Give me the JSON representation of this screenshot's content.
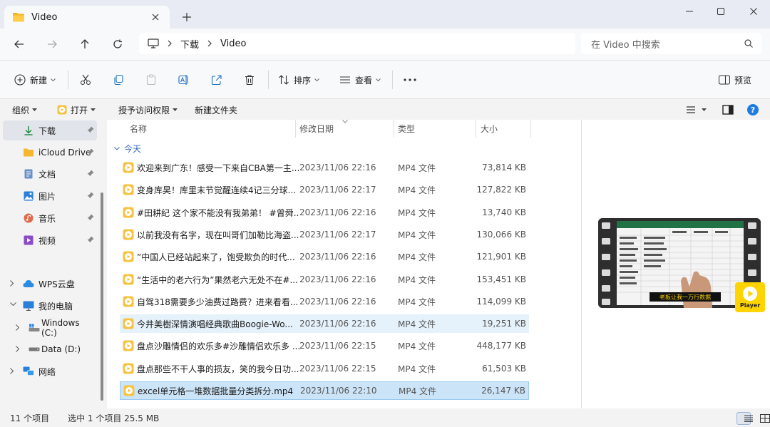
{
  "tab": {
    "title": "Video"
  },
  "address": {
    "segments": [
      "下载",
      "Video"
    ]
  },
  "search": {
    "placeholder": "在 Video 中搜索"
  },
  "toolbar": {
    "new_label": "新建",
    "sort_label": "排序",
    "view_label": "查看",
    "preview_label": "预览"
  },
  "commands": {
    "organize": "组织",
    "open": "打开",
    "grant_access": "授予访问权限",
    "new_folder": "新建文件夹"
  },
  "sidebar": {
    "items": [
      {
        "label": "下载"
      },
      {
        "label": "iCloud Drive"
      },
      {
        "label": "文档"
      },
      {
        "label": "图片"
      },
      {
        "label": "音乐"
      },
      {
        "label": "视频"
      },
      {
        "label": "WPS云盘"
      },
      {
        "label": "我的电脑"
      },
      {
        "label": "Windows (C:)"
      },
      {
        "label": "Data (D:)"
      },
      {
        "label": "网络"
      }
    ]
  },
  "columns": {
    "name": "名称",
    "date": "修改日期",
    "type": "类型",
    "size": "大小"
  },
  "group": {
    "label": "今天"
  },
  "files": [
    {
      "name": "欢迎来到广东！感受一下来自CBA第一主...",
      "date": "2023/11/06 22:16",
      "type": "MP4 文件",
      "size": "73,814 KB"
    },
    {
      "name": "变身库昊！库里末节觉醒连续4记三分球...",
      "date": "2023/11/06 22:17",
      "type": "MP4 文件",
      "size": "127,822 KB"
    },
    {
      "name": "#田耕纪 这个家不能没有我弟弟！ #曾舜...",
      "date": "2023/11/06 22:16",
      "type": "MP4 文件",
      "size": "13,740 KB"
    },
    {
      "name": "以前我没有名字，现在叫哥们加勒比海盗...",
      "date": "2023/11/06 22:17",
      "type": "MP4 文件",
      "size": "130,066 KB"
    },
    {
      "name": "”中国人已经站起来了，饱受欺负的时代...",
      "date": "2023/11/06 22:16",
      "type": "MP4 文件",
      "size": "121,901 KB"
    },
    {
      "name": "“生活中的老六行为”果然老六无处不在#...",
      "date": "2023/11/06 22:16",
      "type": "MP4 文件",
      "size": "153,451 KB"
    },
    {
      "name": "自驾318需要多少油费过路费？进来看看...",
      "date": "2023/11/06 22:16",
      "type": "MP4 文件",
      "size": "114,099 KB"
    },
    {
      "name": "今井美樹深情演唱经典歌曲Boogie-Wo...",
      "date": "2023/11/06 22:16",
      "type": "MP4 文件",
      "size": "19,251 KB"
    },
    {
      "name": "盘点沙雕情侣的欢乐多#沙雕情侣欢乐多 ...",
      "date": "2023/11/06 22:15",
      "type": "MP4 文件",
      "size": "448,177 KB"
    },
    {
      "name": "盘点那些不干人事的损友，笑的我今日功...",
      "date": "2023/11/06 22:15",
      "type": "MP4 文件",
      "size": "61,503 KB"
    },
    {
      "name": "excel单元格一堆数据批量分类拆分.mp4",
      "date": "2023/11/06 22:10",
      "type": "MP4 文件",
      "size": "26,147 KB"
    }
  ],
  "preview": {
    "player_label": "Player",
    "caption": "老板让我一万行数据"
  },
  "status": {
    "count": "11 个项目",
    "selected": "选中 1 个项目  25.5 MB"
  },
  "colors": {
    "accent": "#0067c0",
    "group": "#3168c4",
    "player": "#ffd400",
    "file_icon": "#f6c343"
  }
}
